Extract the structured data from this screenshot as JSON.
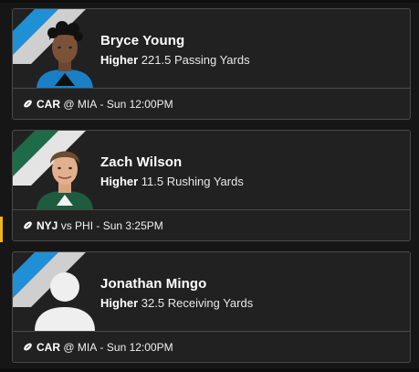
{
  "picks": [
    {
      "player": "Bryce Young",
      "direction": "Higher",
      "line": "221.5",
      "stat": "Passing Yards",
      "team": "CAR",
      "separator": "@",
      "opponent": "MIA",
      "time": "Sun 12:00PM",
      "stripe_colors": [
        "#1f8fd6",
        "#cfcfcf"
      ],
      "avatar": "player-headshot"
    },
    {
      "player": "Zach Wilson",
      "direction": "Higher",
      "line": "11.5",
      "stat": "Rushing Yards",
      "team": "NYJ",
      "separator": "vs",
      "opponent": "PHI",
      "time": "Sun 3:25PM",
      "stripe_colors": [
        "#1e6b4a",
        "#e4e4e4"
      ],
      "avatar": "player-headshot"
    },
    {
      "player": "Jonathan Mingo",
      "direction": "Higher",
      "line": "32.5",
      "stat": "Receiving Yards",
      "team": "CAR",
      "separator": "@",
      "opponent": "MIA",
      "time": "Sun 12:00PM",
      "stripe_colors": [
        "#1f8fd6",
        "#cfcfcf"
      ],
      "avatar": "default-avatar-icon"
    }
  ],
  "colors": {
    "card_bg": "#212121",
    "card_border": "#4a4a4a",
    "accent": "#f1b51c"
  }
}
